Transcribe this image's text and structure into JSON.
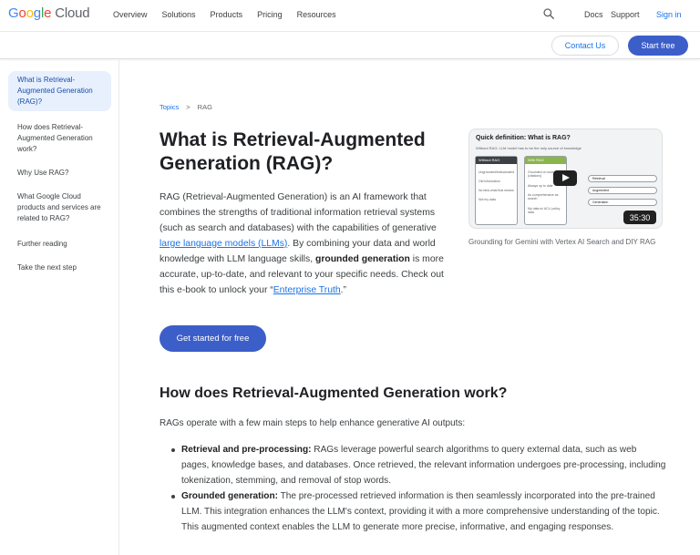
{
  "header": {
    "logo_letters": [
      "G",
      "o",
      "o",
      "g",
      "l",
      "e"
    ],
    "logo_product": "Cloud",
    "nav": [
      "Overview",
      "Solutions",
      "Products",
      "Pricing",
      "Resources"
    ],
    "search_icon": "search-icon",
    "docs": "Docs",
    "support": "Support",
    "signin": "Sign in"
  },
  "subbar": {
    "contact": "Contact Us",
    "start": "Start free"
  },
  "sidebar": {
    "items": [
      "What is Retrieval-Augmented Generation (RAG)?",
      "How does Retrieval-Augmented Generation work?",
      "Why Use RAG?",
      "What Google Cloud products and services are related to RAG?",
      "Further reading",
      "Take the next step"
    ]
  },
  "breadcrumb": {
    "topics": "Topics",
    "separator": ">",
    "current": "RAG"
  },
  "main": {
    "title": "What is Retrieval-Augmented Generation (RAG)?",
    "intro_1": "RAG (Retrieval-Augmented Generation) is an AI framework that combines the strengths of traditional information retrieval systems (such as search and databases) with the capabilities of generative",
    "intro_link_1": " large language models (LLMs)",
    "intro_2": ". By combining your data and world knowledge with LLM language skills, ",
    "intro_bold": "grounded generation",
    "intro_3": " is more accurate, up-to-date, and relevant to your specific needs. Check out this e-book to unlock your “",
    "intro_link_2": "Enterprise Truth",
    "intro_4": ".”",
    "cta": "Get started for free"
  },
  "video": {
    "title": "Quick definition: What is RAG?",
    "subtitle": "Without RAG: LLM model has to be the only source of knowledge",
    "panel_left": "Without RAG",
    "panel_right": "With RAG",
    "left_lines": [
      "Ungrounded/hallucinated",
      "Old information",
      "No idea what that means",
      "Not my data"
    ],
    "right_lines": [
      "Grounded on source data (citations)",
      "Always up to date",
      "As comprehensive as search",
      "My data w/ ACL/ policy data"
    ],
    "rows": [
      "Retrieval",
      "Augmented",
      "Generation"
    ],
    "duration": "35:30",
    "caption": "Grounding for Gemini with Vertex AI Search and DIY RAG"
  },
  "section2": {
    "heading": "How does Retrieval-Augmented Generation work?",
    "intro": "RAGs operate with a few main steps to help enhance generative AI outputs:",
    "bullets": [
      {
        "title": "Retrieval and pre-processing:",
        "text": " RAGs leverage powerful search algorithms to query external data, such as web pages, knowledge bases, and databases. Once retrieved, the relevant information undergoes pre-processing, including tokenization, stemming, and removal of stop words."
      },
      {
        "title": "Grounded generation:",
        "text": " The pre-processed retrieved information is then seamlessly incorporated into the pre-trained LLM. This integration enhances the LLM's context, providing it with a more comprehensive understanding of the topic. This augmented context enables the LLM to generate more precise, informative, and engaging responses."
      }
    ]
  },
  "colors": {
    "primary_button": "#3c5ec9",
    "link": "#1a73e8",
    "sidebar_active_bg": "#e8f0fe",
    "panel_left_header": "#3c4043",
    "panel_right_header": "#8ab54a"
  }
}
